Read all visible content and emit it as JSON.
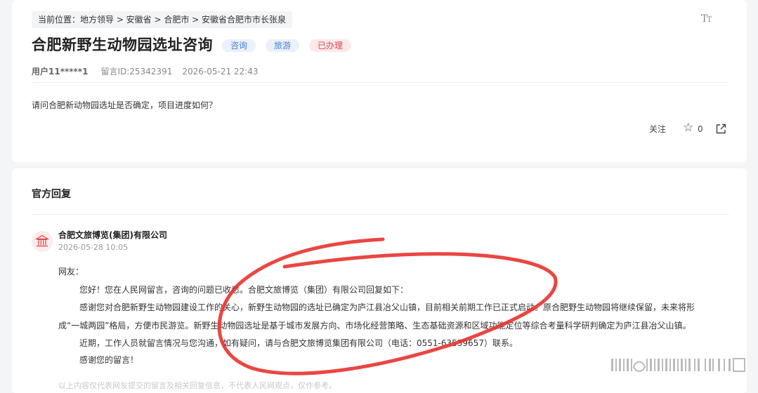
{
  "breadcrumb": "当前位置：地方领导 > 安徽省 > 合肥市 > 安徽省合肥市市长张泉",
  "font_toggle": {
    "big": "T",
    "small": "T"
  },
  "title": "合肥新野生动物园选址咨询",
  "tags": [
    "咨询",
    "旅游",
    "已办理"
  ],
  "meta": {
    "user": "用户11*****1",
    "message_id": "留言ID:25342391",
    "time": "2026-05-21 22:43"
  },
  "question": "请问合肥新动物园选址是否确定，项目进度如何？",
  "actions": {
    "follow_label": "关注",
    "like_count": "0"
  },
  "reply": {
    "section_title": "官方回复",
    "org_name": "合肥文旅博览(集团)有限公司",
    "date": "2026-05-28 10:05",
    "greeting": "网友：",
    "p1": "您好！您在人民网留言，咨询的问题已收悉。合肥文旅博览（集团）有限公司回复如下：",
    "p2a": "感谢您对合肥新野生动物园建设工作的关心，新野生动物园的选址已确定为庐江县冶父山镇，目前相关前期工作已正式启动。原合肥野生动物园将继续保留，未来将形",
    "p2b": "成“一城两园”格局，方便市民游览。新野生动物园选址是基于城市发展方向、市场化经营策略、生态基础资源和区域功能定位等综合考量科学研判确定为庐江县冶父山镇。",
    "p3": "近期，工作人员就留言情况与您沟通，如有疑问，请与合肥文旅博览集团有限公司（电话：0551-63539657）联系。",
    "p4": "感谢您的留言！",
    "faded_line": "以上内容仅代表网友提交的留言及相关回复信息，不代表人民网观点，仅作参考。"
  },
  "colors": {
    "annotation_red": "#e8322e",
    "tag_blue": "#4a7fd0",
    "tag_red": "#e0474f"
  }
}
